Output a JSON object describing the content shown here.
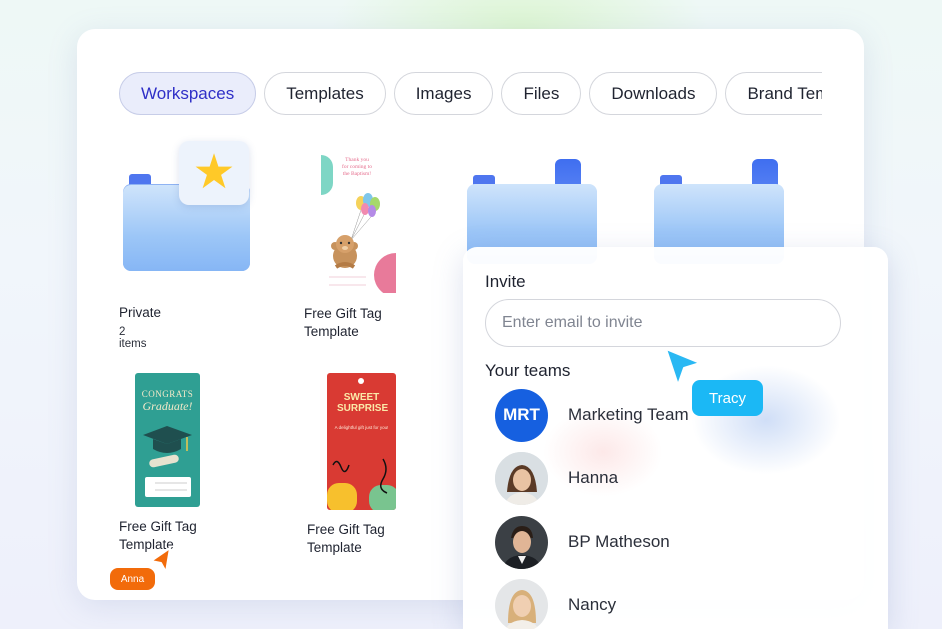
{
  "tabs": [
    {
      "label": "Workspaces",
      "active": true
    },
    {
      "label": "Templates",
      "active": false
    },
    {
      "label": "Images",
      "active": false
    },
    {
      "label": "Files",
      "active": false
    },
    {
      "label": "Downloads",
      "active": false
    },
    {
      "label": "Brand Templates",
      "active": false
    }
  ],
  "grid": {
    "private": {
      "title": "Private",
      "subtitle": "2 items",
      "badge_icon": "star-icon"
    },
    "gift_tag_1": {
      "title": "Free Gift Tag Template",
      "text_lines": [
        "Thank you",
        "for coming to",
        "the Baptism!"
      ]
    },
    "gift_tag_2": {
      "title": "Free Gift Tag Template",
      "text_lines": [
        "CONGRATS",
        "Graduate!"
      ]
    },
    "gift_tag_3": {
      "title": "Free Gift Tag Template",
      "text_lines": [
        "SWEET SURPRISE",
        "A delightful gift just for you!"
      ]
    }
  },
  "invite": {
    "label": "Invite",
    "placeholder": "Enter email to invite",
    "teams_label": "Your teams",
    "teams": [
      {
        "name": "Marketing Team",
        "initials": "MRT",
        "avatar_color": "#1660e0"
      },
      {
        "name": "Hanna"
      },
      {
        "name": "BP Matheson"
      },
      {
        "name": "Nancy"
      }
    ]
  },
  "cursors": {
    "tracy": {
      "name": "Tracy",
      "color": "#1bb8f5"
    },
    "anna": {
      "name": "Anna",
      "color": "#f26b0a"
    }
  },
  "colors": {
    "accent": "#2f2fc7",
    "active_tab_bg": "#eaedfb",
    "folder_blue": "#4f76ef"
  }
}
